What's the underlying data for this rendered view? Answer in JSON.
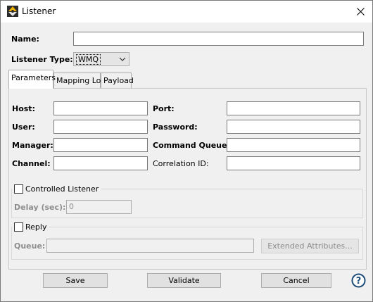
{
  "window": {
    "title": "Listener"
  },
  "form": {
    "name_label": "Name:",
    "name_value": "",
    "listener_type_label": "Listener Type:",
    "listener_type_value": "WMQ"
  },
  "tabs": [
    {
      "label": "Parameters",
      "active": true
    },
    {
      "label": "Mapping Log",
      "active": false
    },
    {
      "label": "Payload",
      "active": false
    }
  ],
  "parameters": {
    "host_label": "Host:",
    "host_value": "",
    "port_label": "Port:",
    "port_value": "",
    "user_label": "User:",
    "user_value": "",
    "password_label": "Password:",
    "password_value": "",
    "manager_label": "Manager:",
    "manager_value": "",
    "command_queue_label": "Command Queue:",
    "command_queue_value": "",
    "channel_label": "Channel:",
    "channel_value": "",
    "correlation_id_label": "Correlation ID:",
    "correlation_id_value": ""
  },
  "controlled_listener": {
    "label": "Controlled Listener",
    "checked": false,
    "delay_label": "Delay (sec):",
    "delay_value": "0"
  },
  "reply": {
    "label": "Reply",
    "checked": false,
    "queue_label": "Queue:",
    "queue_value": "",
    "extended_attributes_label": "Extended Attributes..."
  },
  "buttons": {
    "save": "Save",
    "validate": "Validate",
    "cancel": "Cancel"
  },
  "colors": {
    "window_bg": "#f0f0f0",
    "field_border": "#7a7a7a",
    "disabled_text": "#8d8d8d",
    "help_icon": "#1f4e79"
  },
  "icons": {
    "app": "listener-app-icon",
    "close": "close-icon",
    "help": "help-icon",
    "dropdown": "chevron-down-icon"
  }
}
